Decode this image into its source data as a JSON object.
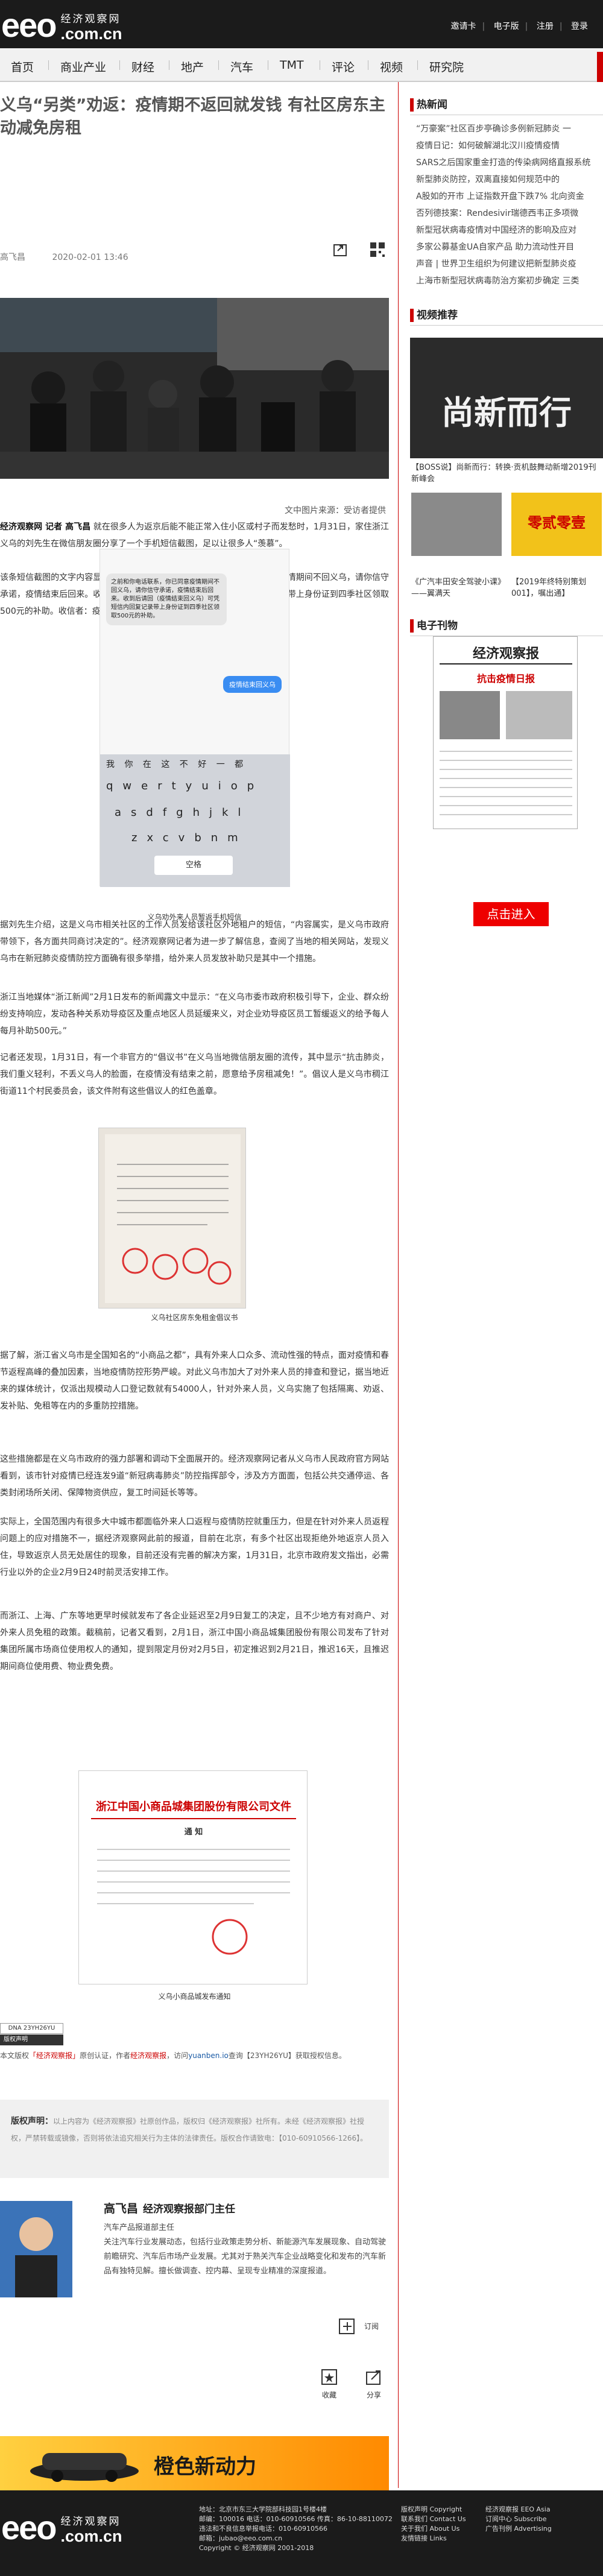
{
  "header": {
    "logo_en": "eeo",
    "logo_domain": ".com.cn",
    "logo_cn": "经济观察网",
    "top_links": [
      "邀请卡",
      "电子版",
      "注册",
      "登录"
    ]
  },
  "nav": [
    "首页",
    "商业产业",
    "财经",
    "地产",
    "汽车",
    "TMT",
    "评论",
    "视频",
    "研究院"
  ],
  "article": {
    "title": "义乌“另类”劝返：疫情期不返回就发钱 有社区房东主动减免房租",
    "author": "高飞昌",
    "date": "2020-02-01 13:46",
    "image_source": "文中图片来源：受访者提供",
    "p1_lead": "经济观察网 记者 高飞昌",
    "p1": "就在很多人为返京后能不能正常入住小区或村子而发愁时，1月31日，家住浙江义乌的刘先生在微信朋友圈分享了一个手机短信截图，足以让很多人“羡慕”。",
    "p2": "该条短信截图的文字内容显示如下。发信者：之前和你电话联系。你已同意疫情期间不回义乌，请你信守承诺，疫情结束后回来。收到后请回（疫情结束回义乌）可凭短信内回复记录带上身份证到四季社区领取500元的补助。收信者：疫情结束回义乌。",
    "phone_sms": "之前和你电话联系，你已同意疫情期间不回义乌，请你信守承诺，疫情结束后回来。收到后请回（疫情结束回义乌）可凭短信内回复记录带上身份证到四季社区领取500元的补助。",
    "phone_reply": "疫情结束回义乌",
    "phone_keys_row1": "qwertyuiop",
    "phone_keys_row2": "asdfghjkl",
    "phone_keys_row3": "zxcvbnm",
    "phone_suggest": "我 你 在 这 不 好 一 都",
    "phone_space": "空格",
    "cap1": "义乌劝外来人员暂返手机短信",
    "p3": "据刘先生介绍，这是义乌市相关社区的工作人员发给该社区外地租户的短信，“内容属实，是义乌市政府带领下，各方面共同商讨决定的”。经济观察网记者为进一步了解信息，查阅了当地的相关网站，发现义乌市在新冠肺炎疫情防控方面确有很多举措，给外来人员发放补助只是其中一个措施。",
    "p4": "浙江当地媒体“浙江新闻”2月1日发布的新闻露文中显示：“在义乌市委市政府积极引导下，企业、群众纷纷支持响应，发动各种关系劝导疫区及重点地区人员延缓来义，对企业劝导疫区员工暂缓返义的给予每人每月补助500元。”",
    "p5": "记者还发现，1月31日，有一个非官方的“倡议书”在义乌当地微信朋友圈的流传，其中显示“抗击肺炎，我们重义轻利，不丢义乌人的脸面，在疫情没有结束之前，愿意给予房租减免！”。倡议人是义乌市稠江街道11个村民委员会，该文件附有这些倡议人的红色盖章。",
    "cap2": "义乌社区房东免租金倡议书",
    "p6": "据了解，浙江省义乌市是全国知名的“小商品之都”，具有外来人口众多、流动性强的特点，面对疫情和春节返程高峰的叠加因素，当地疫情防控形势严峻。对此义乌市加大了对外来人员的排查和登记，据当地近来的媒体统计，仅派出规模动人口登记数就有54000人，针对外来人员，义乌实施了包括隔离、劝返、发补贴、免租等在内的多重防控措施。",
    "p7": "这些措施都是在义乌市政府的强力部署和调动下全面展开的。经济观察网记者从义乌市人民政府官方网站看到，该市针对疫情已经连发9道“新冠病毒肺炎”防控指挥部令，涉及方方面面，包括公共交通停运、各类封闭场所关闭、保障物资供应，复工时间延长等等。",
    "p8": "实际上，全国范围内有很多大中城市都面临外来人口返程与疫情防控就重压力，但是在针对外来人员返程问题上的应对措施不一，据经济观察网此前的报道，目前在北京，有多个社区出现拒绝外地返京人员入住，导致返京人员无处居住的现象，目前还没有完善的解决方案，1月31日，北京市政府发文指出，必需行业以外的企业2月9日24时前灵活安排工作。",
    "p9": "而浙江、上海、广东等地更早时候就发布了各企业延迟至2月9日复工的决定，且不少地方有对商户、对外来人员免租的政策。截稿前，记者又看到，2月1日，浙江中国小商品城集团股份有限公司发布了针对集团所属市场商位使用权人的通知，提到限定月份对2月5日，初定推迟到2月21日，推迟16天，且推迟期间商位使用费、物业费免费。",
    "doc_title": "浙江中国小商品城集团股份有限公司文件",
    "doc_sub": "通 知",
    "cap3": "义乌小商品城发布通知",
    "tag1": "DNA 23YH26YU",
    "tag2": "版权声明",
    "source_prefix": "本文版权",
    "source_mid": "原创认证，作者",
    "source_red": "经济观察报",
    "source_tail": "，访问",
    "source_blue": "yuanben.io",
    "source_tail2": "查询【23YH26YU】获取授权信息。"
  },
  "rights": {
    "head": "版权声明：",
    "text": "以上内容为《经济观察报》社原创作品，版权归《经济观察报》社所有。未经《经济观察报》社授权，严禁转载或镜像，否则将依法追究相关行为主体的法律责任。版权合作请致电：【010-60910566-1266】。"
  },
  "author": {
    "name": "高飞昌",
    "role": "经济观察报部门主任",
    "desc_title": "汽车产品报道部主任",
    "desc": "关注汽车行业发展动态，包括行业政策走势分析、新能源汽车发展现象、自动驾驶前瞻研究、汽车后市场产业发展。尤其对于熟关汽车企业战略变化和发布的汽车新品有独特见解。擅长做调查、控内幕、呈现专业精准的深度报道。",
    "follow": "订阅",
    "collect": "收藏",
    "share": "分享"
  },
  "sidebar": {
    "hot_title": "热新闻",
    "hot_items": [
      "“万豪案”社区百步亭确诊多例新冠肺炎 一",
      "疫情日记：如何破解湖北汉川疫情疫情",
      "SARS之后国家重金打造的传染病网络直报系统",
      "新型肺炎防控，双离直接如何规范中的",
      "A股如的开市 上证指数开盘下跌7% 北向资金",
      "否列德技案：Rendesivir瑞德西韦正多项微",
      "新型冠状病毒疫情对中国经济的影响及应对",
      "多家公募基金UA自家产品 助力流动性开目",
      "声音 | 世界卫生组织为何建议把新型肺炎疫",
      "上海市新型冠状病毒防治方案初步确定 三类"
    ],
    "video_title": "视频推荐",
    "video_big_caption": "【BOSS说】尚新而行：转换·贡机鼓舞动新增2019刊新峰会",
    "video_big_text": "尚新而行",
    "video_small": [
      {
        "caption": "《广汽丰田安全驾驶小课》——翼满天",
        "text": ""
      },
      {
        "caption": "【2019年终特别策划001】，嘱出通】",
        "text": "零贰零壹"
      }
    ],
    "paper_title": "电子刊物",
    "paper_name": "经济观察报",
    "paper_head": "抗击疫情日报",
    "paper_button": "点击进入"
  },
  "banner": {
    "text": "橙色新动力"
  },
  "footer": {
    "logo_en": "eeo",
    "logo_cn": "经济观察网",
    "logo_domain": ".com.cn",
    "col1": [
      "地址：北京市东三大学院部科技园1号楼4楼",
      "邮编：100016  电话：010-60910566  传真：86-10-88110072",
      "违法和不良信息举报电话：010-60910566",
      "邮箱：jubao@eeo.com.cn",
      "Copyright © 经济观察网 2001-2018"
    ],
    "col2": [
      "版权声明 Copyright",
      "联系我们 Contact Us",
      "关于我们 About Us",
      "友情链接 Links"
    ],
    "col3": [
      "经济观察报 EEO Asia",
      "订阅中心 Subscribe",
      "广告刊例 Advertising"
    ]
  },
  "colors": {
    "accent": "#c00000",
    "brand_orange": "#e8380d",
    "dark_bar": "#1b1b1b"
  }
}
